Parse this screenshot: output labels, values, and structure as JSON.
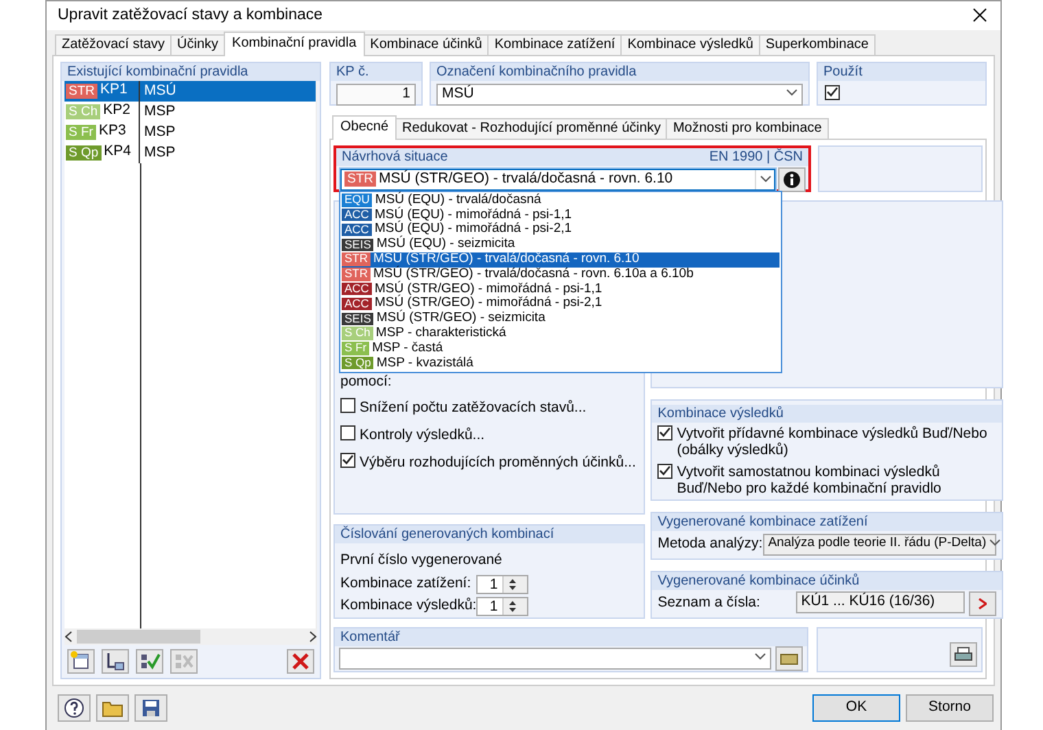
{
  "window": {
    "title": "Upravit zatěžovací stavy a kombinace"
  },
  "tabs": [
    {
      "label": "Zatěžovací stavy",
      "selected": false
    },
    {
      "label": "Účinky",
      "selected": false
    },
    {
      "label": "Kombinační pravidla",
      "selected": true
    },
    {
      "label": "Kombinace účinků",
      "selected": false
    },
    {
      "label": "Kombinace zatížení",
      "selected": false
    },
    {
      "label": "Kombinace výsledků",
      "selected": false
    },
    {
      "label": "Superkombinace",
      "selected": false
    }
  ],
  "rules_panel": {
    "title": "Existující kombinační pravidla",
    "rows": [
      {
        "tag": "STR",
        "color": "#e0645c",
        "number": "KP1",
        "name": "MSÚ",
        "selected": true
      },
      {
        "tag": "S Ch",
        "color": "#a8cf7c",
        "number": "KP2",
        "name": "MSP",
        "selected": false
      },
      {
        "tag": "S Fr",
        "color": "#8cbf4f",
        "number": "KP3",
        "name": "MSP",
        "selected": false
      },
      {
        "tag": "S Qp",
        "color": "#6f9b2c",
        "number": "KP4",
        "name": "MSP",
        "selected": false
      }
    ]
  },
  "rule_number": {
    "label": "KP č.",
    "value": "1"
  },
  "rule_name": {
    "label": "Označení kombinačního pravidla",
    "value": "MSÚ"
  },
  "use": {
    "label": "Použít",
    "checked": true
  },
  "subtabs": [
    {
      "label": "Obecné",
      "selected": true
    },
    {
      "label": "Redukovat - Rozhodující proměnné účinky",
      "selected": false
    },
    {
      "label": "Možnosti pro kombinace",
      "selected": false
    }
  ],
  "design_situation": {
    "label": "Návrhová situace",
    "standard": "EN 1990 | ČSN",
    "tag": "STR",
    "color": "#e0645c",
    "value": "MSÚ (STR/GEO) - trvalá/dočasná - rovn. 6.10",
    "expanded": true,
    "options": [
      {
        "tag": "EQU",
        "color": "#1a7fd4",
        "text": "MSÚ (EQU) - trvalá/dočasná",
        "selected": false
      },
      {
        "tag": "ACC",
        "color": "#1f5ea6",
        "text": "MSÚ (EQU) - mimořádná - psi-1,1",
        "selected": false
      },
      {
        "tag": "ACC",
        "color": "#1f5ea6",
        "text": "MSÚ (EQU) - mimořádná - psi-2,1",
        "selected": false
      },
      {
        "tag": "SEIS",
        "color": "#3a3a3a",
        "text": "MSÚ (EQU) - seizmicita",
        "selected": false
      },
      {
        "tag": "STR",
        "color": "#e0645c",
        "text": "MSÚ (STR/GEO) - trvalá/dočasná - rovn. 6.10",
        "selected": true
      },
      {
        "tag": "STR",
        "color": "#e0645c",
        "text": "MSÚ (STR/GEO) - trvalá/dočasná - rovn. 6.10a a 6.10b",
        "selected": false
      },
      {
        "tag": "ACC",
        "color": "#a3232a",
        "text": "MSÚ (STR/GEO) - mimořádná - psi-1,1",
        "selected": false
      },
      {
        "tag": "ACC",
        "color": "#a3232a",
        "text": "MSÚ (STR/GEO) - mimořádná - psi-2,1",
        "selected": false
      },
      {
        "tag": "SEIS",
        "color": "#3a3a3a",
        "text": "MSÚ (STR/GEO) - seizmicita",
        "selected": false
      },
      {
        "tag": "S Ch",
        "color": "#a8cf7c",
        "text": "MSP - charakteristická",
        "selected": false
      },
      {
        "tag": "S Fr",
        "color": "#8cbf4f",
        "text": "MSP - častá",
        "selected": false
      },
      {
        "tag": "S Qp",
        "color": "#6f9b2c",
        "text": "MSP - kvazistálá",
        "selected": false
      }
    ]
  },
  "options_panel": {
    "caption": "pomocí:",
    "checkboxes": [
      {
        "label": "Snížení počtu zatěžovacích stavů...",
        "checked": false
      },
      {
        "label": "Kontroly výsledků...",
        "checked": false
      },
      {
        "label": "Výběru rozhodujících proměnných účinků...",
        "checked": true
      }
    ]
  },
  "numbering": {
    "title": "Číslování generovaných kombinací",
    "caption": "První číslo vygenerované",
    "fields": [
      {
        "label": "Kombinace zatížení:",
        "value": "1"
      },
      {
        "label": "Kombinace výsledků:",
        "value": "1"
      }
    ]
  },
  "result_combinations": {
    "title": "Kombinace výsledků",
    "checkboxes": [
      {
        "label": "Vytvořit přídavné kombinace výsledků Buď/Nebo (obálky výsledků)",
        "checked": true
      },
      {
        "label": "Vytvořit samostatnou kombinaci výsledků Buď/Nebo pro každé kombinační pravidlo",
        "checked": true
      }
    ]
  },
  "generated_load": {
    "title": "Vygenerované kombinace zatížení",
    "label": "Metoda analýzy:",
    "value": "Analýza podle teorie II. řádu (P-Delta)"
  },
  "generated_effects": {
    "title": "Vygenerované kombinace účinků",
    "label": "Seznam a čísla:",
    "value": "KÚ1 ... KÚ16 (16/36)"
  },
  "comment": {
    "title": "Komentář"
  },
  "buttons": [
    {
      "label": "OK",
      "default": true
    },
    {
      "label": "Storno",
      "default": false
    }
  ]
}
